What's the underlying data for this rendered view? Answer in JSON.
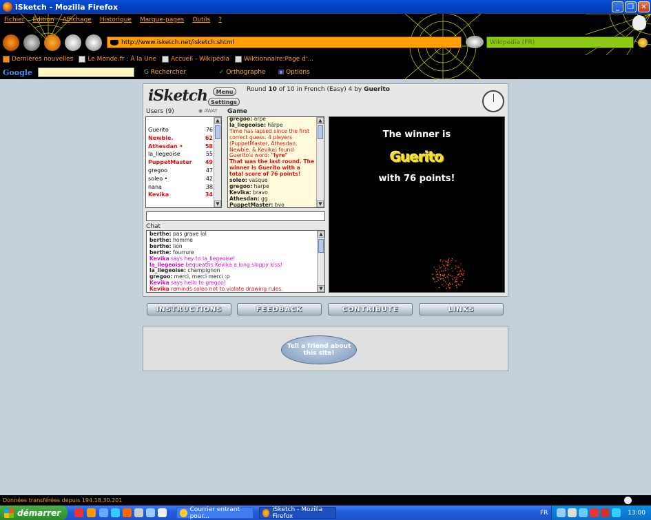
{
  "window": {
    "title": "iSketch - Mozilla Firefox",
    "minimize": "_",
    "maximize": "❐",
    "close": "✕"
  },
  "menu": [
    "Fichier",
    "Édition",
    "Affichage",
    "Historique",
    "Marque-pages",
    "Outils",
    "?"
  ],
  "url": "http://www.isketch.net/isketch.shtml",
  "search_placeholder": "Wikipedia (FR)",
  "bookmarks": [
    "Dernières nouvelles",
    "Le Monde.fr : À la Une",
    "Accueil - Wikipédia",
    "Wiktionnaire:Page d'..."
  ],
  "google_toolbar": {
    "logo": "Google",
    "search_label": "Rechercher",
    "spelling_label": "Orthographe",
    "options_label": "Options"
  },
  "game": {
    "logo": "iSketch",
    "menu_button": "Menu",
    "settings_button": "Settings",
    "round_prefix": "Round",
    "round": "10",
    "round_of": "of 10 in French (Easy) 4 by",
    "drawer": "Guerito",
    "users_label": "Users (9)",
    "away_label": "AWAY",
    "game_label": "Game",
    "chat_label": "Chat",
    "users": [
      {
        "name": "Guerito",
        "score": "76",
        "highlight": false
      },
      {
        "name": "Newbie.",
        "score": "62",
        "highlight": true
      },
      {
        "name": "Athesdan •",
        "score": "58",
        "highlight": true
      },
      {
        "name": "la_liegeoise",
        "score": "55",
        "highlight": false
      },
      {
        "name": "PuppetMaster",
        "score": "49",
        "highlight": true
      },
      {
        "name": "gregoo",
        "score": "47",
        "highlight": false
      },
      {
        "name": "soleo •",
        "score": "42",
        "highlight": false
      },
      {
        "name": "nana",
        "score": "38",
        "highlight": false
      },
      {
        "name": "Kevika",
        "score": "34",
        "highlight": true
      }
    ],
    "game_log": [
      {
        "who": "gregoo:",
        "text": " arpe",
        "style": "n"
      },
      {
        "who": "la_liegeoise:",
        "text": " hârpe",
        "style": "n"
      },
      {
        "who": "",
        "text": "Time has lapsed since the first correct guess. 4 players (PuppetMaster, Athesdan, Newbie. & Kevika) found Guerito's word: ",
        "style": "r",
        "extra": "\"lyre\""
      },
      {
        "who": "",
        "text": "That was the last round. The winner is Guerito with a total score of 76 points!",
        "style": "rb"
      },
      {
        "who": "soleo:",
        "text": " vasque",
        "style": "n"
      },
      {
        "who": "gregoo:",
        "text": " harpe",
        "style": "n"
      },
      {
        "who": "Kevika:",
        "text": " bravo",
        "style": "n"
      },
      {
        "who": "Athesdan:",
        "text": " gg",
        "style": "n"
      },
      {
        "who": "PuppetMaster:",
        "text": " bvo",
        "style": "n"
      }
    ],
    "winner_line1": "The winner is",
    "winner_name": "Guerito",
    "winner_line3": "with 76 points!",
    "chat": [
      {
        "a": "berthe:",
        "b": " pas grave lol",
        "style": "n"
      },
      {
        "a": "berthe:",
        "b": " homme",
        "style": "n"
      },
      {
        "a": "berthe:",
        "b": " lion",
        "style": "n"
      },
      {
        "a": "berthe:",
        "b": " fourrure",
        "style": "n"
      },
      {
        "a": "Kevika",
        "b": " says hey to la_liegeoise!",
        "style": "m"
      },
      {
        "a": "la_liegeoise",
        "b": " bequeaths Kevika a long sloppy kiss!",
        "style": "m"
      },
      {
        "a": "la_liegeoise:",
        "b": " champignon",
        "style": "n"
      },
      {
        "a": "gregoo:",
        "b": " merci, merci merci :p",
        "style": "n"
      },
      {
        "a": "Kevika",
        "b": " says hello to gregoo!",
        "style": "m"
      },
      {
        "a": "Kevika",
        "b": " reminds soleo not to violate drawing rules.",
        "style": "r"
      }
    ]
  },
  "nav_buttons": [
    "INSTRUCTIONS",
    "FEEDBACK",
    "CONTRIBUTE",
    "LINKS"
  ],
  "tell_friend": "Tell a friend about this site!",
  "status": "Données transférées depuis 194.18.30.201",
  "taskbar": {
    "start": "démarrer",
    "tasks": [
      "Courrier entrant pour...",
      "iSketch - Mozilla Firefox"
    ],
    "lang": "FR",
    "clock": "13:00"
  }
}
